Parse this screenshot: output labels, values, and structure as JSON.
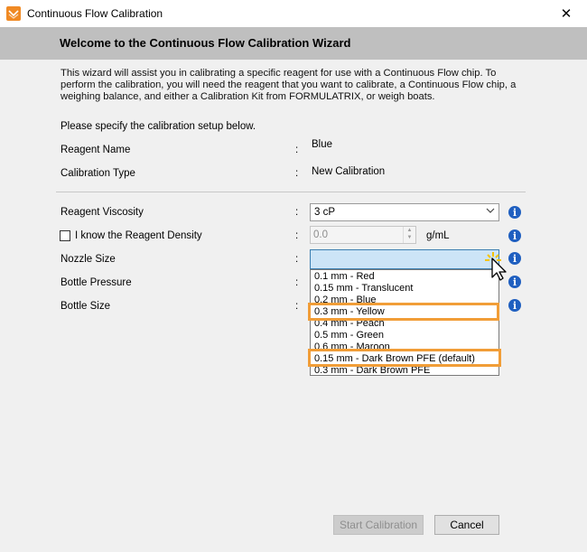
{
  "window": {
    "title": "Continuous Flow Calibration",
    "close_glyph": "✕"
  },
  "header": {
    "title": "Welcome to the Continuous Flow Calibration Wizard"
  },
  "intro": {
    "line1": "This wizard will assist you in calibrating a specific reagent for use with a Continuous Flow chip. To",
    "line2": "perform the calibration, you will need the reagent that you want to calibrate, a Continuous Flow chip, a",
    "line3": "weighing balance, and either a Calibration Kit from FORMULATRIX, or weigh boats."
  },
  "setup": {
    "prompt": "Please specify the calibration setup below.",
    "colon": ":",
    "reagent_name_label": "Reagent Name",
    "reagent_name_value": "Blue",
    "calibration_type_label": "Calibration Type",
    "calibration_type_value": "New Calibration",
    "viscosity_label": "Reagent Viscosity",
    "viscosity_value": "3 cP",
    "density_label": "I know the Reagent Density",
    "density_value": "0.0",
    "density_unit": "g/mL",
    "nozzle_label": "Nozzle Size",
    "bottle_pressure_label": "Bottle Pressure",
    "bottle_size_label": "Bottle Size"
  },
  "nozzle_options": [
    "0.1 mm - Red",
    "0.15 mm - Translucent",
    "0.2 mm - Blue",
    "0.3 mm - Yellow",
    "0.4 mm - Peach",
    "0.5 mm - Green",
    "0.6 mm - Maroon",
    "0.15 mm - Dark Brown PFE (default)",
    "0.3 mm - Dark Brown PFE"
  ],
  "buttons": {
    "start": "Start Calibration",
    "cancel": "Cancel"
  },
  "icons": {
    "info_glyph": "i",
    "app_icon": "envelope-chevron-icon",
    "info_icon": "info-icon",
    "cursor_icon": "mouse-pointer-icon"
  },
  "colors": {
    "highlight": "#f19d37",
    "info": "#1f5fc0",
    "app_icon": "#f08a24"
  }
}
